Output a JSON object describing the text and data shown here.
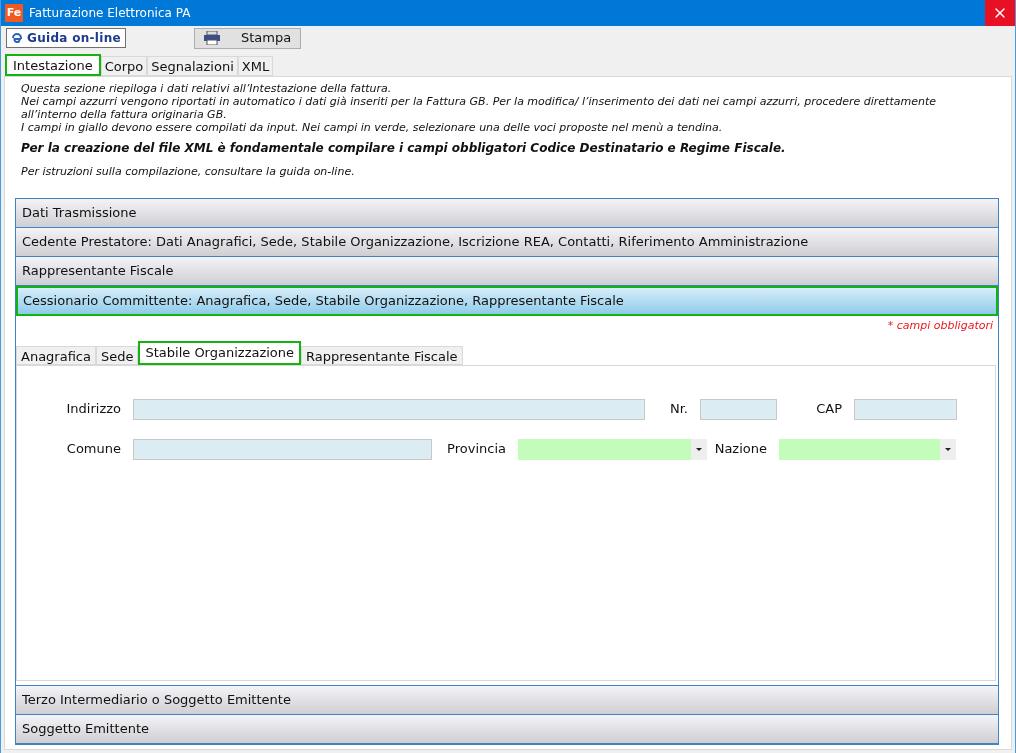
{
  "window": {
    "title": "Fatturazione Elettronica PA",
    "logo": "Fe"
  },
  "toolbar": [
    {
      "kind": "help",
      "label": "Guida on-line"
    },
    {
      "kind": "print",
      "label": "Stampa"
    }
  ],
  "tabs": [
    {
      "label": "Intestazione",
      "selected": true
    },
    {
      "label": "Corpo",
      "selected": false
    },
    {
      "label": "Segnalazioni",
      "selected": false
    },
    {
      "label": "XML",
      "selected": false
    }
  ],
  "info": [
    {
      "kind": "note",
      "text": "Questa sezione riepiloga i dati relativi all’Intestazione della fattura."
    },
    {
      "kind": "note",
      "text": "Nei campi azzurri vengono riportati in automatico i dati già inseriti per la Fattura GB. Per la modifica/ l’inserimento dei dati nei campi azzurri, procedere direttamente all’interno della fattura originaria GB."
    },
    {
      "kind": "note",
      "text": "I campi in giallo devono essere compilati da input. Nei campi in verde, selezionare una delle voci proposte nel menù a tendina."
    },
    {
      "kind": "important",
      "text": "Per la creazione del file XML è fondamentale compilare i campi obbligatori Codice Destinatario e Regime Fiscale."
    },
    {
      "kind": "hint",
      "text": "Per istruzioni sulla compilazione, consultare la guida on-line."
    }
  ],
  "sections": [
    {
      "title": "Dati Trasmissione",
      "expanded": false
    },
    {
      "title": "Cedente Prestatore: Dati Anagrafici, Sede, Stabile Organizzazione, Iscrizione REA, Contatti, Riferimento Amministrazione",
      "expanded": false
    },
    {
      "title": "Rappresentante Fiscale",
      "expanded": false
    },
    {
      "title": "Cessionario Committente: Anagrafica, Sede, Stabile Organizzazione, Rappresentante Fiscale",
      "expanded": true
    },
    {
      "title": "Terzo Intermediario o Soggetto Emittente",
      "expanded": false
    },
    {
      "title": "Soggetto Emittente",
      "expanded": false
    }
  ],
  "required_note": "* campi obbligatori",
  "subtabs": [
    {
      "label": "Anagrafica",
      "selected": false
    },
    {
      "label": "Sede",
      "selected": false
    },
    {
      "label": "Stabile Organizzazione",
      "selected": true
    },
    {
      "label": "Rappresentante Fiscale",
      "selected": false
    }
  ],
  "form_rows": [
    [
      {
        "label": "Indirizzo",
        "kind": "text"
      },
      {
        "label": "Nr.",
        "kind": "text"
      },
      {
        "label": "CAP",
        "kind": "text"
      }
    ],
    [
      {
        "label": "Comune",
        "kind": "text"
      },
      {
        "label": "Provincia",
        "kind": "combo"
      },
      {
        "label": "Nazione",
        "kind": "combo"
      }
    ]
  ]
}
